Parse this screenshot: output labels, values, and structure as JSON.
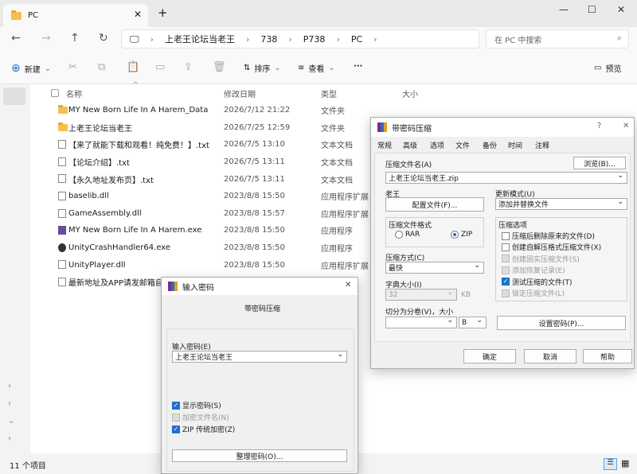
{
  "explorer": {
    "tab_title": "PC",
    "breadcrumb": [
      "上老王论坛当老王",
      "738",
      "P738",
      "PC"
    ],
    "search_placeholder": "在 PC 中搜索",
    "toolbar": {
      "new": "新建",
      "sort": "排序",
      "view": "查看",
      "more": "···",
      "preview": "预览"
    },
    "columns": {
      "name": "名称",
      "date": "修改日期",
      "type": "类型",
      "size": "大小"
    },
    "files": [
      {
        "name": "MY New Born Life In A Harem_Data",
        "date": "2026/7/12 21:22",
        "type": "文件夹",
        "icon": "folder-icon"
      },
      {
        "name": "上老王论坛当老王",
        "date": "2026/7/25 12:59",
        "type": "文件夹",
        "icon": "folder-icon"
      },
      {
        "name": "【来了就能下载和观看！纯免费！】.txt",
        "date": "2026/7/5 13:10",
        "type": "文本文档",
        "icon": "text-file-icon"
      },
      {
        "name": "【论坛介绍】.txt",
        "date": "2026/7/5 13:11",
        "type": "文本文档",
        "icon": "text-file-icon"
      },
      {
        "name": "【永久地址发布页】.txt",
        "date": "2026/7/5 13:11",
        "type": "文本文档",
        "icon": "text-file-icon"
      },
      {
        "name": "baselib.dll",
        "date": "2023/8/8 15:50",
        "type": "应用程序扩展",
        "icon": "dll-file-icon"
      },
      {
        "name": "GameAssembly.dll",
        "date": "2023/8/8 15:57",
        "type": "应用程序扩展",
        "icon": "dll-file-icon"
      },
      {
        "name": "MY New Born Life In A Harem.exe",
        "date": "2023/8/8 15:50",
        "type": "应用程序",
        "icon": "game-exe-icon"
      },
      {
        "name": "UnityCrashHandler64.exe",
        "date": "2023/8/8 15:50",
        "type": "应用程序",
        "icon": "unity-exe-icon"
      },
      {
        "name": "UnityPlayer.dll",
        "date": "2023/8/8 15:50",
        "type": "应用程序扩展",
        "icon": "dll-file-icon"
      },
      {
        "name": "最新地址及APP请发邮箱自动",
        "date": "",
        "type": "",
        "icon": "text-file-icon"
      }
    ],
    "status": "11 个项目"
  },
  "archive_dialog": {
    "title": "带密码压缩",
    "tabs": [
      "常规",
      "高级",
      "选项",
      "文件",
      "备份",
      "时间",
      "注释"
    ],
    "filename_label": "压缩文件名(A)",
    "filename_value": "上老王论坛当老王.zip",
    "browse": "浏览(B)...",
    "profile_label": "老王",
    "profile_button": "配置文件(F)...",
    "update_label": "更新模式(U)",
    "update_value": "添加并替换文件",
    "format_label": "压缩文件格式",
    "format_rar": "RAR",
    "format_zip": "ZIP",
    "method_label": "压缩方式(C)",
    "method_value": "最快",
    "dict_label": "字典大小(I)",
    "dict_value": "32",
    "dict_unit": "KB",
    "split_label": "切分为分卷(V)，大小",
    "split_unit": "B",
    "options_label": "压缩选项",
    "options": [
      {
        "label": "压缩后删除原来的文件(D)",
        "checked": false,
        "disabled": false
      },
      {
        "label": "创建自解压格式压缩文件(X)",
        "checked": false,
        "disabled": false
      },
      {
        "label": "创建固实压缩文件(S)",
        "checked": false,
        "disabled": true
      },
      {
        "label": "添加恢复记录(E)",
        "checked": false,
        "disabled": true
      },
      {
        "label": "测试压缩的文件(T)",
        "checked": true,
        "disabled": false
      },
      {
        "label": "锁定压缩文件(L)",
        "checked": false,
        "disabled": true
      }
    ],
    "set_password": "设置密码(P)...",
    "ok": "确定",
    "cancel": "取消",
    "help": "帮助",
    "help_q": "?",
    "close": "✕"
  },
  "password_dialog": {
    "title": "输入密码",
    "subtitle": "带密码压缩",
    "password_label": "输入密码(E)",
    "password_value": "上老王论坛当老王",
    "show_password": "显示密码(S)",
    "encrypt_names": "加密文件名(N)",
    "zip_legacy": "ZIP 传统加密(Z)",
    "organize": "整理密码(O)...",
    "close": "✕"
  }
}
